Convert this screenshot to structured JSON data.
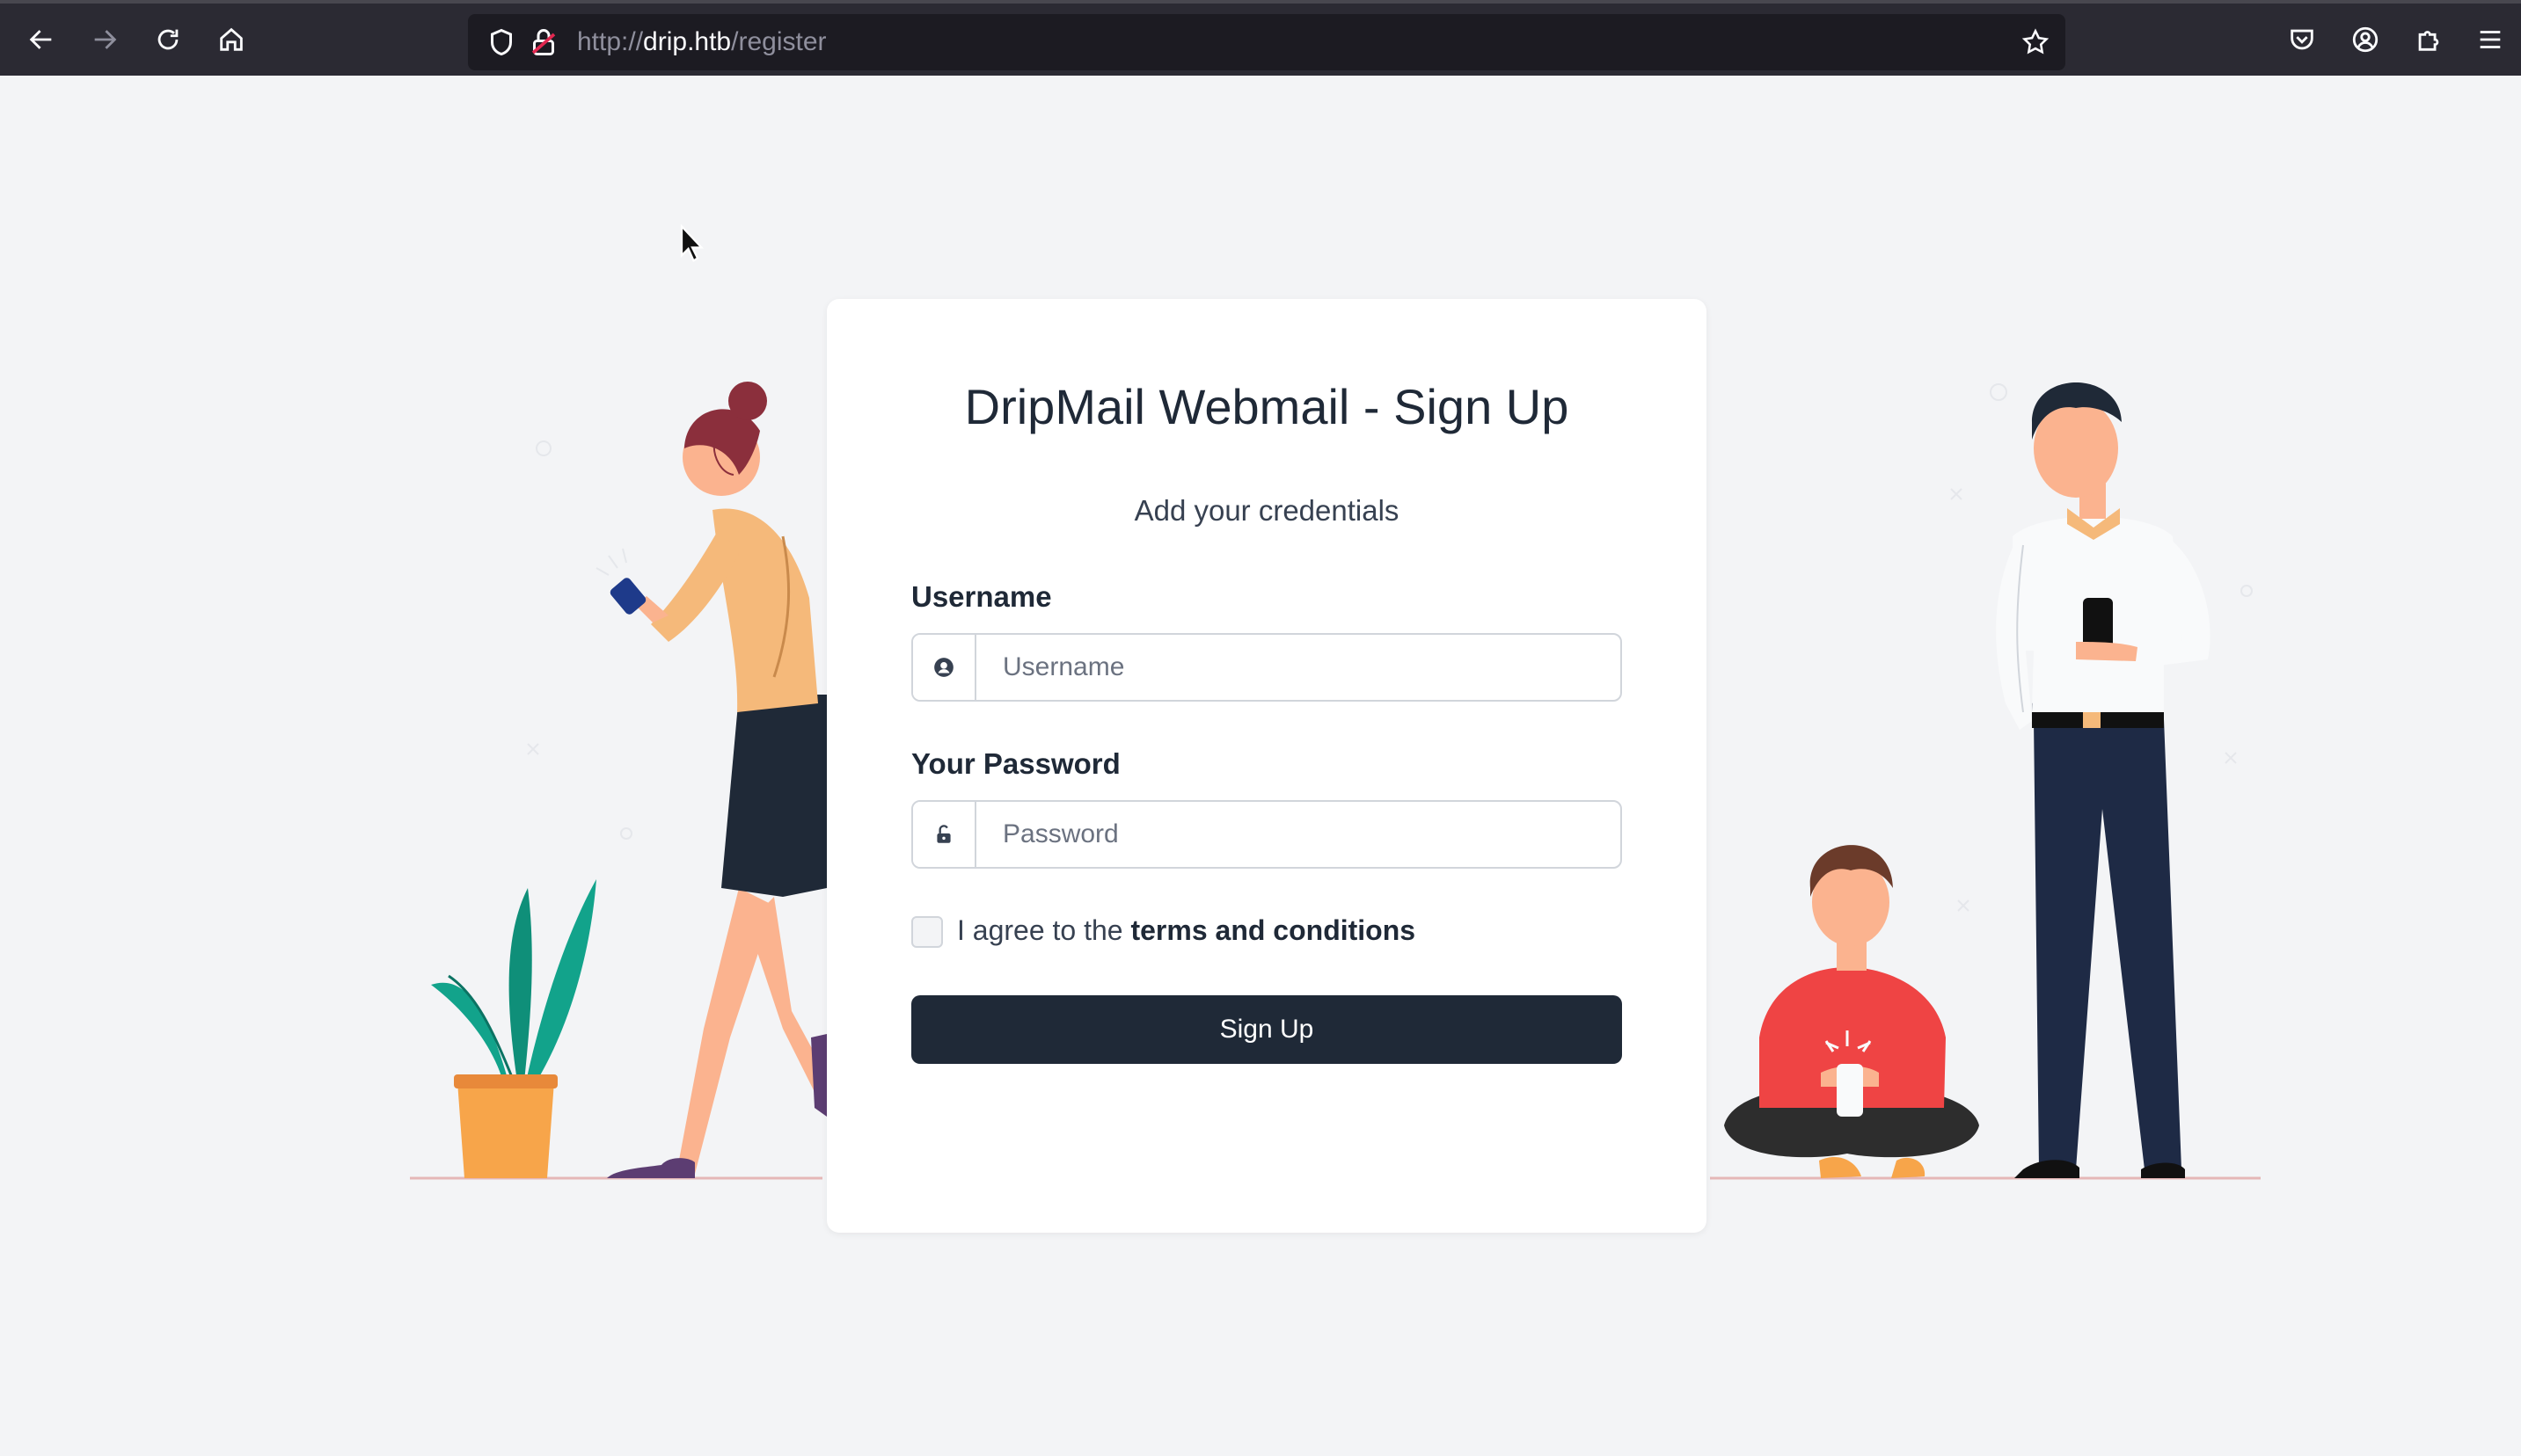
{
  "browser": {
    "url_scheme": "http://",
    "url_host": "drip.htb",
    "url_path": "/register"
  },
  "page": {
    "title": "DripMail Webmail - Sign Up",
    "subtitle": "Add your credentials"
  },
  "form": {
    "username_label": "Username",
    "username_placeholder": "Username",
    "password_label": "Your Password",
    "password_placeholder": "Password",
    "agree_prefix": "I agree to the ",
    "agree_link": "terms and conditions",
    "submit_label": "Sign Up"
  },
  "icons": {
    "back": "back-arrow-icon",
    "forward": "forward-arrow-icon",
    "reload": "reload-icon",
    "home": "home-icon",
    "shield": "shield-icon",
    "lock": "lock-insecure-icon",
    "bookmark": "star-icon",
    "pocket": "pocket-icon",
    "account": "account-icon",
    "extensions": "puzzle-icon",
    "menu": "hamburger-menu-icon",
    "user_addon": "user-circle-icon",
    "password_addon": "unlock-icon"
  },
  "colors": {
    "page_bg": "#f3f4f6",
    "button_bg": "#1f2937",
    "toolbar_bg": "#2b2a33"
  }
}
